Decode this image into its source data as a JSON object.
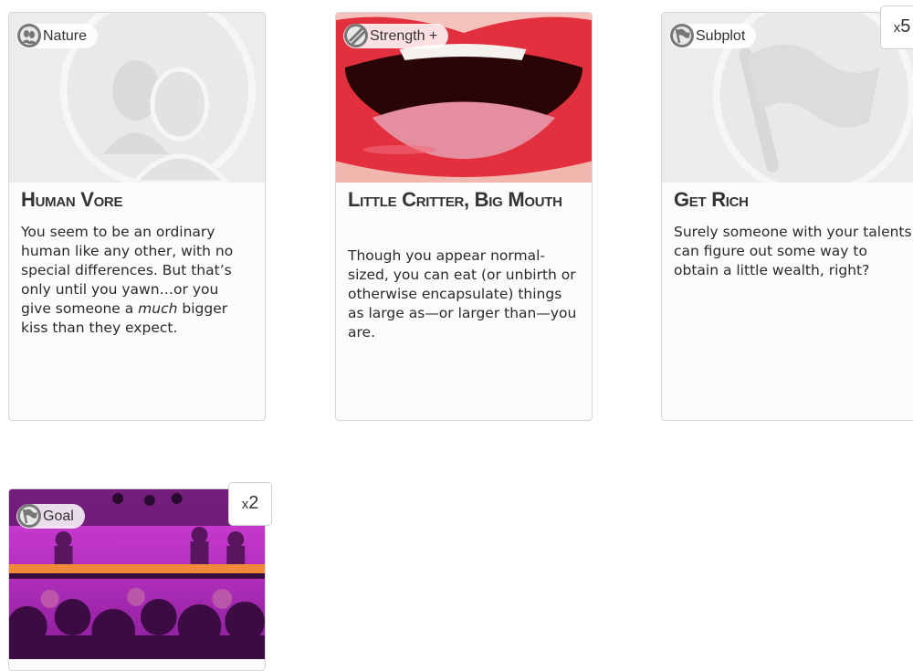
{
  "cards": [
    {
      "tag": "Nature",
      "title": "Human Vore",
      "desc_before": "You seem to be an ordinary human like any other, with no special differences. But that’s only until you yawn…or you give someone a ",
      "desc_em": "much",
      "desc_after": " bigger kiss than they expect.",
      "icon": "nature-faces-icon"
    },
    {
      "tag": "Strength +",
      "title": "Little Critter, Big Mouth",
      "desc": "Though you appear normal-sized, you can eat (or unbirth or otherwise encapsulate) things as large as—or larger than—you are.",
      "icon": "strength-slash-icon"
    },
    {
      "tag": "Subplot",
      "title": "Get Rich",
      "desc": "Surely someone with your talents can figure out some way to obtain a little wealth, right?",
      "icon": "subplot-flag-icon",
      "count_prefix": "x",
      "count": "5"
    },
    {
      "tag": "Goal",
      "icon": "goal-flag-icon",
      "count_prefix": "x",
      "count": "2"
    }
  ],
  "colors": {
    "card_bg": "#fbfbfb",
    "border": "#d6d6d6",
    "lips": "#e2303f",
    "party": "#c42ad0"
  }
}
